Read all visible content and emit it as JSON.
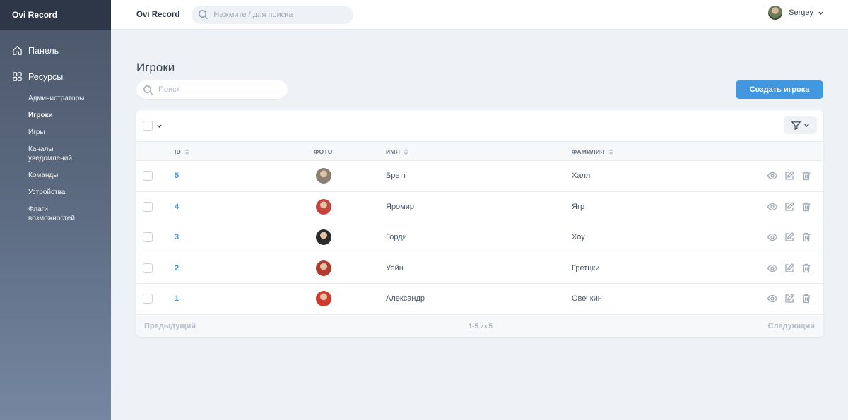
{
  "sidebar": {
    "brand": "Ovi Record",
    "dashboard_label": "Панель",
    "resources_label": "Ресурсы",
    "items": [
      {
        "label": "Администраторы"
      },
      {
        "label": "Игроки"
      },
      {
        "label": "Игры"
      },
      {
        "label": "Каналы уведомлений"
      },
      {
        "label": "Команды"
      },
      {
        "label": "Устройства"
      },
      {
        "label": "Флаги возможностей"
      }
    ],
    "active_item": "Игроки"
  },
  "topbar": {
    "title": "Ovi Record",
    "search_placeholder": "Нажмите / для поиска",
    "user_name": "Sergey"
  },
  "main": {
    "page_title": "Игроки",
    "search_placeholder": "Поиск",
    "create_label": "Создать игрока"
  },
  "table": {
    "headers": {
      "id": "ID",
      "photo": "ФОТО",
      "first_name": "ИМЯ",
      "last_name": "ФАМИЛИЯ"
    },
    "rows": [
      {
        "id": "5",
        "first_name": "Бретт",
        "last_name": "Халл",
        "photo_color": "#8a7f73"
      },
      {
        "id": "4",
        "first_name": "Яромир",
        "last_name": "Ягр",
        "photo_color": "#c8433c"
      },
      {
        "id": "3",
        "first_name": "Горди",
        "last_name": "Хоу",
        "photo_color": "#2b2b2b"
      },
      {
        "id": "2",
        "first_name": "Уэйн",
        "last_name": "Гретцки",
        "photo_color": "#b33a2f"
      },
      {
        "id": "1",
        "first_name": "Александр",
        "last_name": "Овечкин",
        "photo_color": "#d2382e"
      }
    ]
  },
  "pagination": {
    "prev_label": "Предыдущий",
    "info": "1-5 из 5",
    "next_label": "Следующий"
  },
  "colors": {
    "accent": "#4198e0",
    "sidebar_top": "#2d3748"
  }
}
